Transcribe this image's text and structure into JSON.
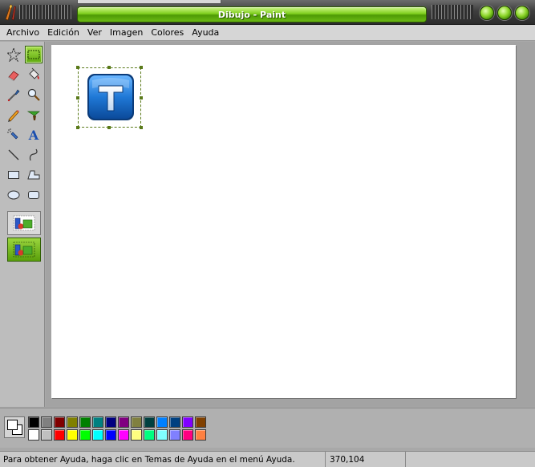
{
  "window": {
    "title": "Dibujo - Paint",
    "accent": "#7fcf1c",
    "controls": [
      {
        "name": "minimize-button",
        "icon": "green-orb-icon"
      },
      {
        "name": "maximize-button",
        "icon": "green-orb-icon"
      },
      {
        "name": "close-button",
        "icon": "green-orb-icon"
      }
    ]
  },
  "menu": [
    "Archivo",
    "Edición",
    "Ver",
    "Imagen",
    "Colores",
    "Ayuda"
  ],
  "tools": [
    {
      "name": "free-form-select",
      "icon": "star-select-icon"
    },
    {
      "name": "rect-select",
      "icon": "rect-select-icon",
      "active": true
    },
    {
      "name": "eraser",
      "icon": "eraser-icon"
    },
    {
      "name": "fill",
      "icon": "paint-bucket-icon"
    },
    {
      "name": "pick-color",
      "icon": "eyedropper-icon"
    },
    {
      "name": "magnifier",
      "icon": "magnifier-icon"
    },
    {
      "name": "pencil",
      "icon": "pencil-icon"
    },
    {
      "name": "brush",
      "icon": "brush-icon"
    },
    {
      "name": "airbrush",
      "icon": "airbrush-icon"
    },
    {
      "name": "text",
      "icon": "text-a-icon"
    },
    {
      "name": "line",
      "icon": "line-icon"
    },
    {
      "name": "curve",
      "icon": "curve-icon"
    },
    {
      "name": "rectangle",
      "icon": "rectangle-icon"
    },
    {
      "name": "polygon",
      "icon": "polygon-icon"
    },
    {
      "name": "ellipse",
      "icon": "ellipse-icon"
    },
    {
      "name": "rounded-rectangle",
      "icon": "rounded-rect-icon"
    }
  ],
  "tool_options": [
    {
      "name": "opaque-selection",
      "icon": "opaque-selection-icon"
    },
    {
      "name": "transparent-selection",
      "icon": "transparent-selection-icon",
      "active": true
    }
  ],
  "canvas": {
    "background": "#ffffff",
    "image_letter": "T",
    "image_color": "#1f78d6"
  },
  "palette": {
    "foreground": "#ffffff",
    "background": "#ffffff",
    "row1": [
      "#000000",
      "#808080",
      "#800000",
      "#808000",
      "#008000",
      "#008080",
      "#000080",
      "#800080",
      "#808040",
      "#004040",
      "#0080ff",
      "#004080",
      "#8000ff",
      "#804000"
    ],
    "row2": [
      "#ffffff",
      "#c0c0c0",
      "#ff0000",
      "#ffff00",
      "#00ff00",
      "#00ffff",
      "#0000ff",
      "#ff00ff",
      "#ffff80",
      "#00ff80",
      "#80ffff",
      "#8080ff",
      "#ff0080",
      "#ff8040"
    ]
  },
  "status": {
    "help_text": "Para obtener Ayuda, haga clic en Temas de Ayuda en el menú Ayuda.",
    "coords": "370,104"
  }
}
